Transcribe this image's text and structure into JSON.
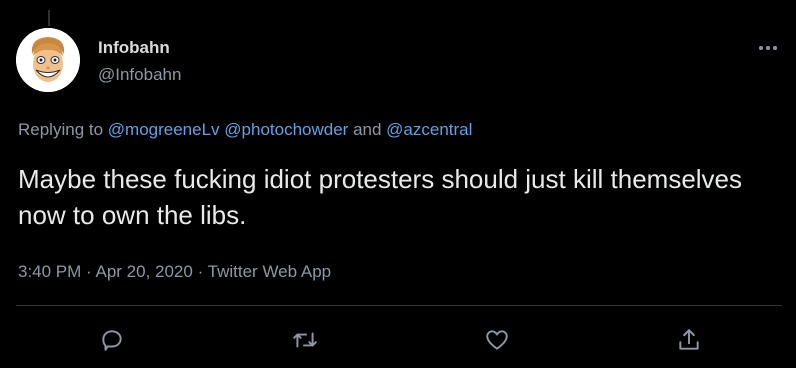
{
  "user": {
    "display_name": "Infobahn",
    "handle": "@Infobahn"
  },
  "reply": {
    "prefix": "Replying to ",
    "mentions": [
      "@mogreeneLv",
      "@photochowder",
      "@azcentral"
    ],
    "conjunction": " and "
  },
  "tweet": {
    "text": "Maybe these fucking idiot protesters should just kill themselves now to own the libs."
  },
  "meta": {
    "time": "3:40 PM",
    "separator": " · ",
    "date": "Apr 20, 2020",
    "source": "Twitter Web App"
  },
  "icons": {
    "more": "more-icon",
    "reply": "reply-icon",
    "retweet": "retweet-icon",
    "like": "heart-icon",
    "share": "share-icon"
  },
  "colors": {
    "background": "#000000",
    "text": "#e7e9ea",
    "muted": "#8b98a5",
    "link": "#5aa3e8",
    "divider": "#2f3336"
  }
}
